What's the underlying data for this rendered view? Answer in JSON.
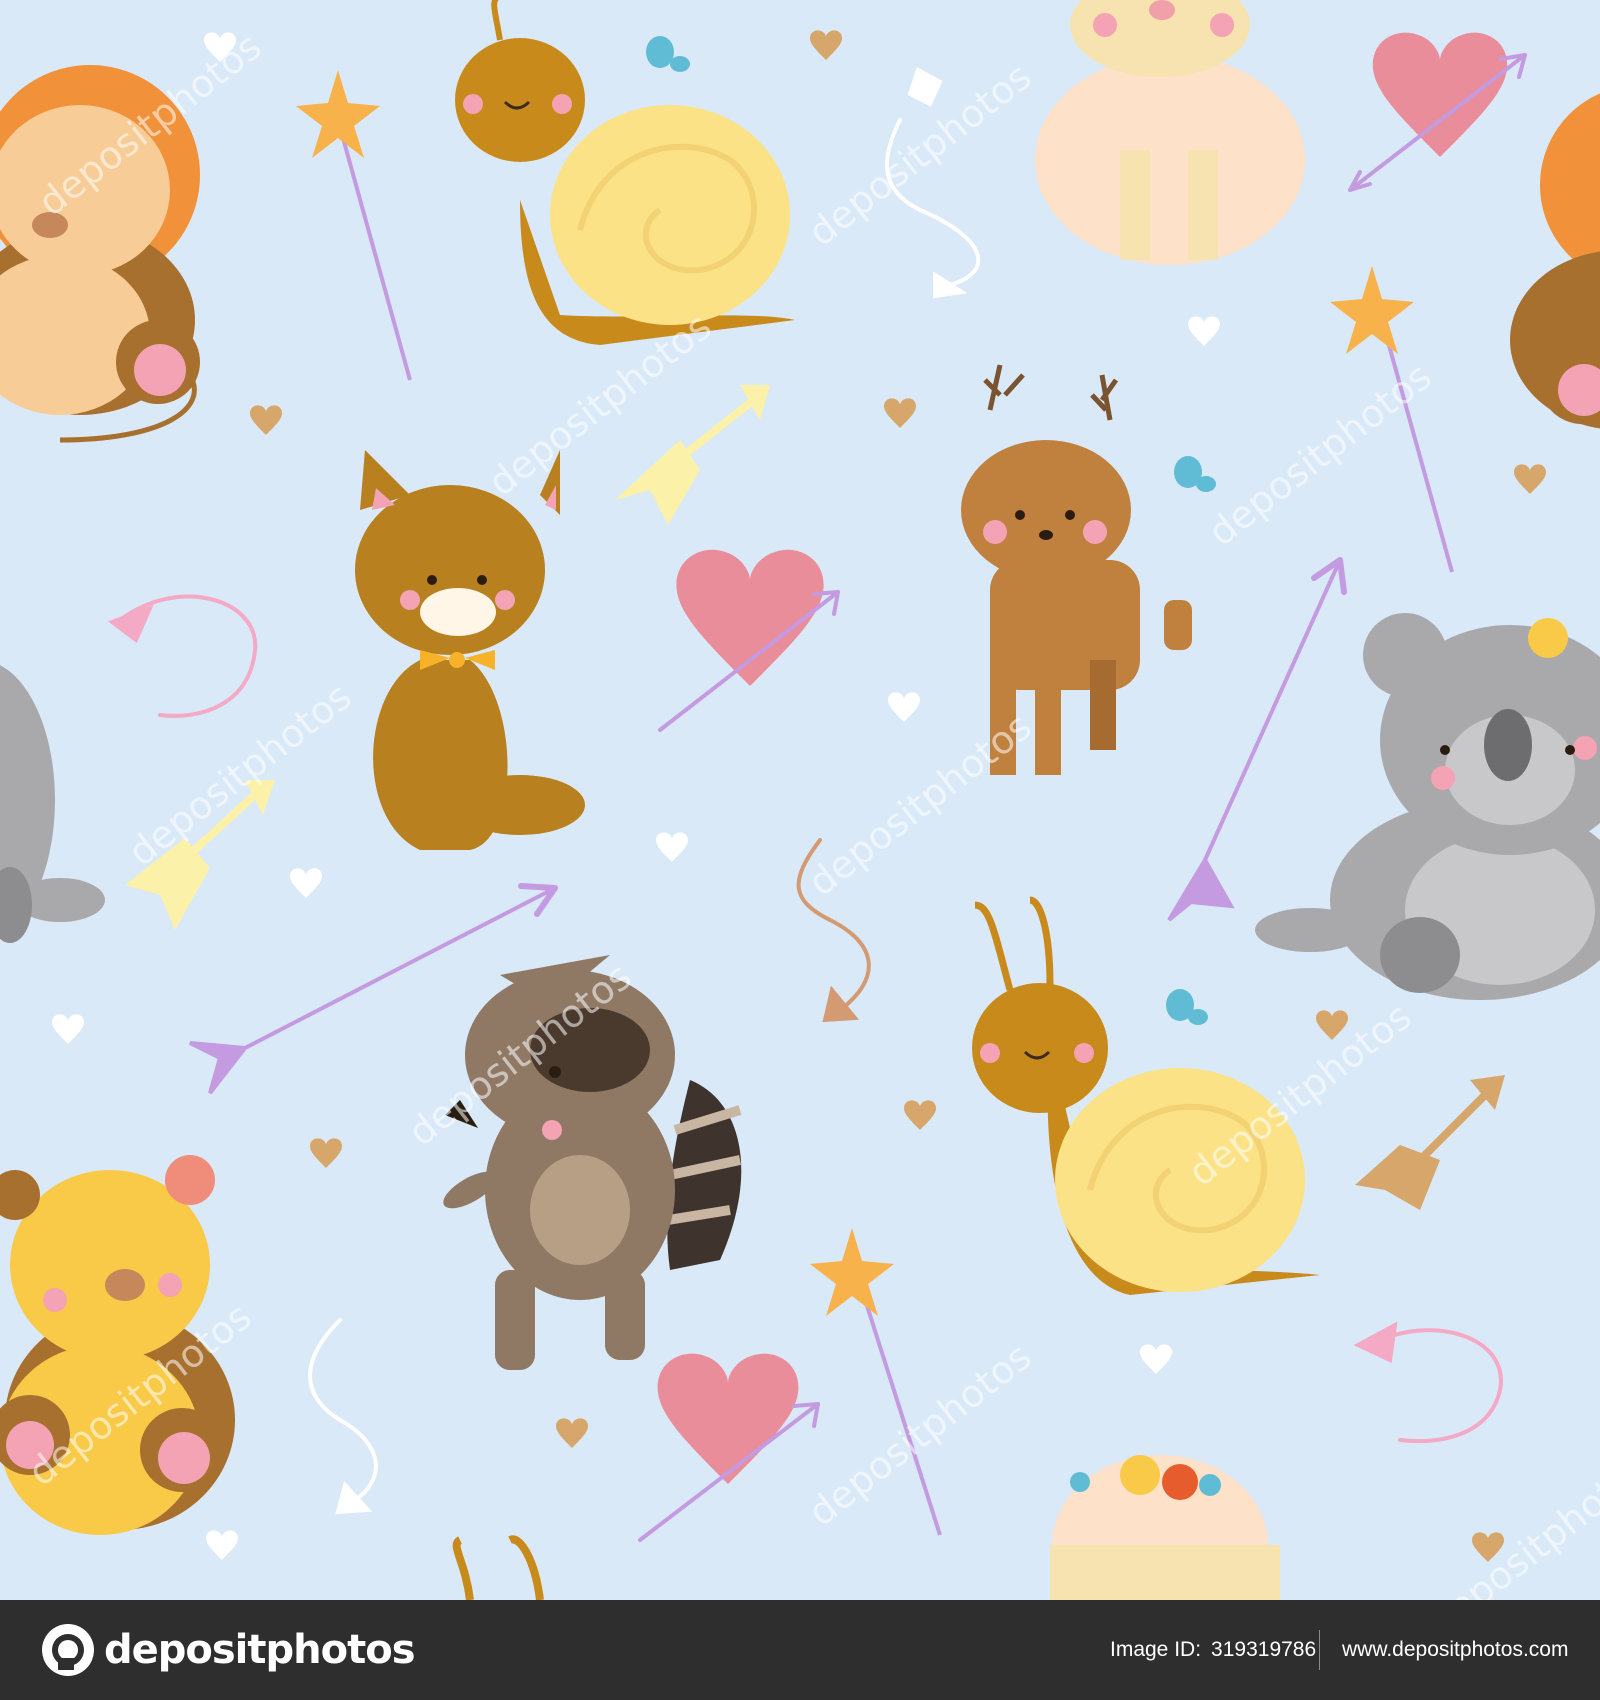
{
  "illustration": {
    "background": "#d9e9f8",
    "colors": {
      "lion_mane": "#f1913a",
      "snail_body": "#c98a1c",
      "snail_shell": "#fbe286",
      "cat": "#b8801f",
      "deer": "#c0803e",
      "koala": "#a9a9ab",
      "raccoon": "#8f7965",
      "leopard": "#f9c948",
      "heart_pink": "#ea8d9a",
      "arrow_purple": "#c49ae0",
      "arrow_yellow": "#fbf1a8",
      "wand_orange": "#f7b24c",
      "small_heart": "#d6a66a"
    },
    "animals": [
      "lion-icon",
      "snail-icon",
      "sheep-icon",
      "cat-icon",
      "deer-icon",
      "koala-icon",
      "raccoon-icon",
      "leopard-icon"
    ],
    "watermark": "depositphotos"
  },
  "footer": {
    "brand": "depositphotos",
    "image_id_label": "Image ID:",
    "image_id": "319319786",
    "site": "www.depositphotos.com"
  }
}
